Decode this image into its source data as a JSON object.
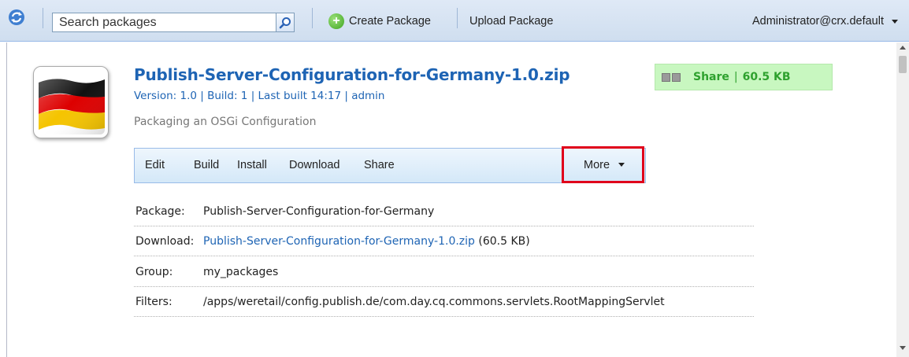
{
  "toolbar": {
    "search_placeholder": "Search packages",
    "create_package_label": "Create Package",
    "upload_package_label": "Upload Package",
    "user_label": "Administrator@crx.default"
  },
  "package": {
    "title": "Publish-Server-Configuration-for-Germany-1.0.zip",
    "meta": "Version: 1.0 | Build: 1 | Last built 14:17 | admin",
    "description": "Packaging an OSGi Configuration",
    "share_label": "Share",
    "share_separator": "|",
    "share_size": "60.5 KB"
  },
  "actions": {
    "edit": "Edit",
    "build": "Build",
    "install": "Install",
    "download": "Download",
    "share": "Share",
    "more": "More"
  },
  "details": {
    "package_label": "Package:",
    "package_value": "Publish-Server-Configuration-for-Germany",
    "download_label": "Download:",
    "download_link": "Publish-Server-Configuration-for-Germany-1.0.zip",
    "download_size": "(60.5 KB)",
    "group_label": "Group:",
    "group_value": "my_packages",
    "filters_label": "Filters:",
    "filters_value": "/apps/weretail/config.publish.de/com.day.cq.commons.servlets.RootMappingServlet"
  },
  "icons": {
    "app": "refresh-icon",
    "search": "magnifier-icon",
    "create": "plus-circle-icon",
    "thumbnail": "germany-flag-icon"
  },
  "colors": {
    "link": "#1e64b4",
    "share_bg": "#c8f7c0",
    "share_text": "#2ea12e",
    "highlight": "#e0001b"
  }
}
